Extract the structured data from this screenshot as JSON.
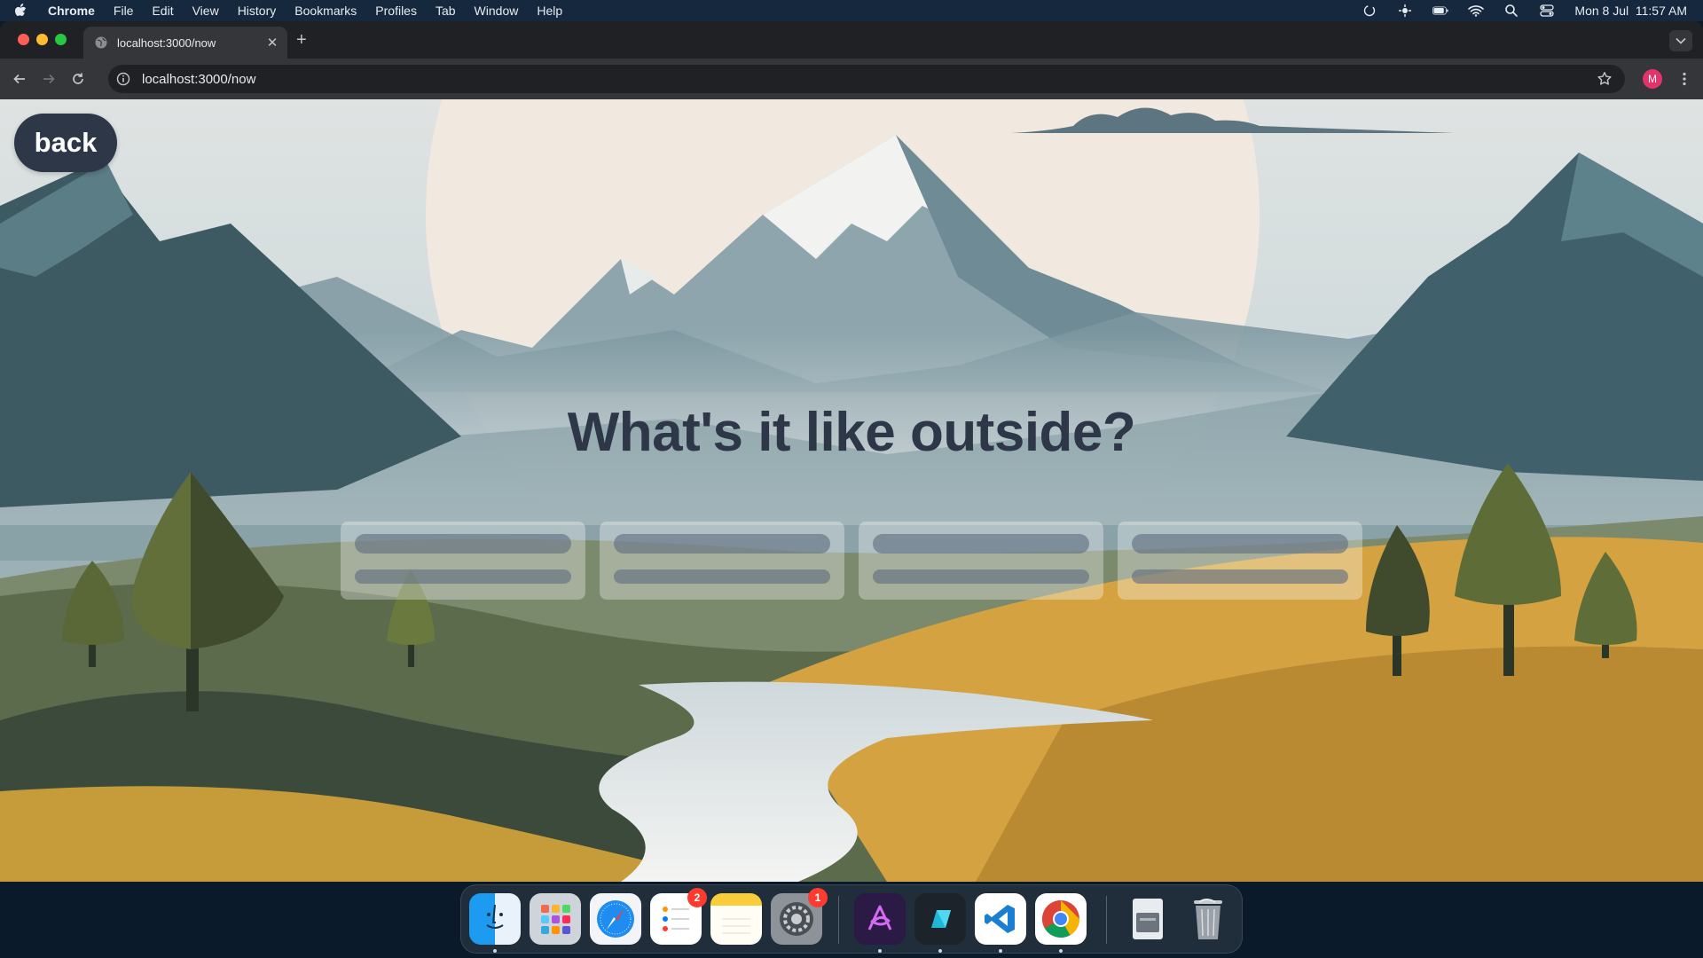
{
  "menubar": {
    "app_name": "Chrome",
    "items": [
      "File",
      "Edit",
      "View",
      "History",
      "Bookmarks",
      "Profiles",
      "Tab",
      "Window",
      "Help"
    ],
    "clock": "Mon 8 Jul  11:57 AM"
  },
  "browser": {
    "tab_title": "localhost:3000/now",
    "url": "localhost:3000/now",
    "profile_initial": "M"
  },
  "page": {
    "back_label": "back",
    "headline": "What's it like outside?",
    "skeleton_cards": 4
  },
  "dock": {
    "reminders_badge": "2",
    "settings_badge": "1"
  },
  "colors": {
    "headline": "#2d3748",
    "back_button": "#2d3748",
    "menubar": "#15283d",
    "profile": "#e2336a"
  }
}
